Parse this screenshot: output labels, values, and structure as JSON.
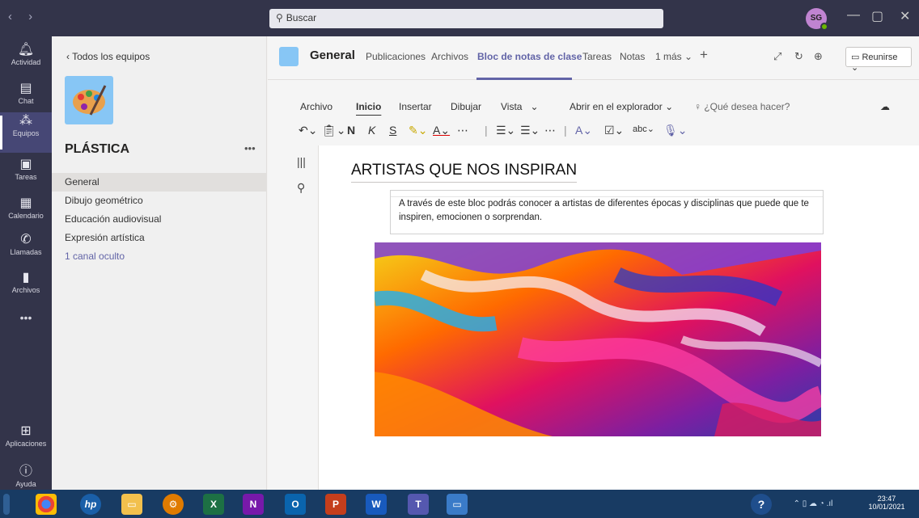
{
  "titlebar": {
    "search_placeholder": "Buscar",
    "avatar_initials": "SG"
  },
  "rail": [
    {
      "label": "Actividad",
      "icon": "bell-icon"
    },
    {
      "label": "Chat",
      "icon": "chat-icon"
    },
    {
      "label": "Equipos",
      "icon": "teams-icon"
    },
    {
      "label": "Tareas",
      "icon": "assignments-icon"
    },
    {
      "label": "Calendario",
      "icon": "calendar-icon"
    },
    {
      "label": "Llamadas",
      "icon": "phone-icon"
    },
    {
      "label": "Archivos",
      "icon": "files-icon"
    },
    {
      "label": "Aplicaciones",
      "icon": "apps-icon"
    },
    {
      "label": "Ayuda",
      "icon": "help-icon"
    }
  ],
  "team": {
    "back_label": "Todos los equipos",
    "name": "PLÁSTICA",
    "channels": [
      "General",
      "Dibujo geométrico",
      "Educación audiovisual",
      "Expresión artística",
      "1 canal oculto"
    ]
  },
  "header": {
    "channel": "General",
    "tabs": [
      "Publicaciones",
      "Archivos",
      "Bloc de notas de clase",
      "Tareas",
      "Notas",
      "1 más"
    ],
    "meet_label": "Reunirse"
  },
  "ribbon": {
    "tabs": [
      "Archivo",
      "Inicio",
      "Insertar",
      "Dibujar",
      "Vista",
      "Abrir en el explorador",
      "¿Qué desea hacer?"
    ],
    "bold": "N",
    "italic": "K",
    "underline": "S"
  },
  "page": {
    "title": "ARTISTAS QUE NOS INSPIRAN",
    "note": "A través de este bloc podrás conocer a artistas de diferentes épocas y disciplinas que puede que te inspiren, emocionen o sorprendan."
  },
  "taskbar": {
    "time": "23:47",
    "date": "10/01/2021"
  },
  "colors": {
    "rail": "#33344a",
    "accent": "#6264a7",
    "taskbar": "#183b63"
  }
}
